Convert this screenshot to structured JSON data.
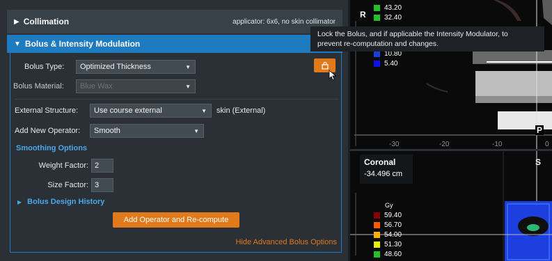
{
  "collimation": {
    "title": "Collimation",
    "info": "applicator: 6x6, no skin collimator"
  },
  "bolus_section": {
    "title": "Bolus & Intensity Modulation"
  },
  "bolus_type": {
    "label": "Bolus Type:",
    "value": "Optimized Thickness"
  },
  "bolus_material": {
    "label": "Bolus Material:",
    "value": "Blue Wax"
  },
  "external_structure": {
    "label": "External Structure:",
    "value": "Use course external",
    "suffix": "skin (External)"
  },
  "add_operator": {
    "label": "Add New Operator:",
    "value": "Smooth"
  },
  "smoothing": {
    "title": "Smoothing Options",
    "weight_label": "Weight Factor:",
    "weight_value": "2",
    "size_label": "Size Factor:",
    "size_value": "3"
  },
  "history": {
    "label": "Bolus Design History"
  },
  "buttons": {
    "recompute": "Add Operator and Re-compute",
    "hide_advanced": "Hide Advanced Bolus Options"
  },
  "tooltip": {
    "line1": "Lock the Bolus, and if applicable the Intensity Modulator, to",
    "line2": "prevent re-computation and changes."
  },
  "icons": {
    "lock": "lock-icon",
    "expand": "triangle-right-icon",
    "collapse": "triangle-down-icon",
    "dropdown": "caret-down-icon"
  },
  "colors": {
    "accent_blue": "#1f7bc0",
    "accent_orange": "#e07a1a",
    "panel_bg": "#2a3036"
  },
  "viewer": {
    "top_legend": [
      {
        "value": "43.20",
        "color": "#22c02a"
      },
      {
        "value": "32.40",
        "color": "#22c02a"
      },
      {
        "value": "10.80",
        "color": "#1b3fd8"
      },
      {
        "value": "5.40",
        "color": "#1010ee"
      }
    ],
    "orient_r": "R",
    "orient_p": "P",
    "orient_s": "S",
    "ruler_labels": [
      "-30",
      "-20",
      "-10",
      "0"
    ],
    "coronal": {
      "title": "Coronal",
      "position": "-34.496 cm"
    },
    "dose_unit": "Gy",
    "bottom_legend": [
      {
        "value": "59.40",
        "color": "#8b0000"
      },
      {
        "value": "56.70",
        "color": "#ff5a00"
      },
      {
        "value": "54.00",
        "color": "#ffb000"
      },
      {
        "value": "51.30",
        "color": "#e5ef00"
      },
      {
        "value": "48.60",
        "color": "#22c02a"
      }
    ]
  }
}
